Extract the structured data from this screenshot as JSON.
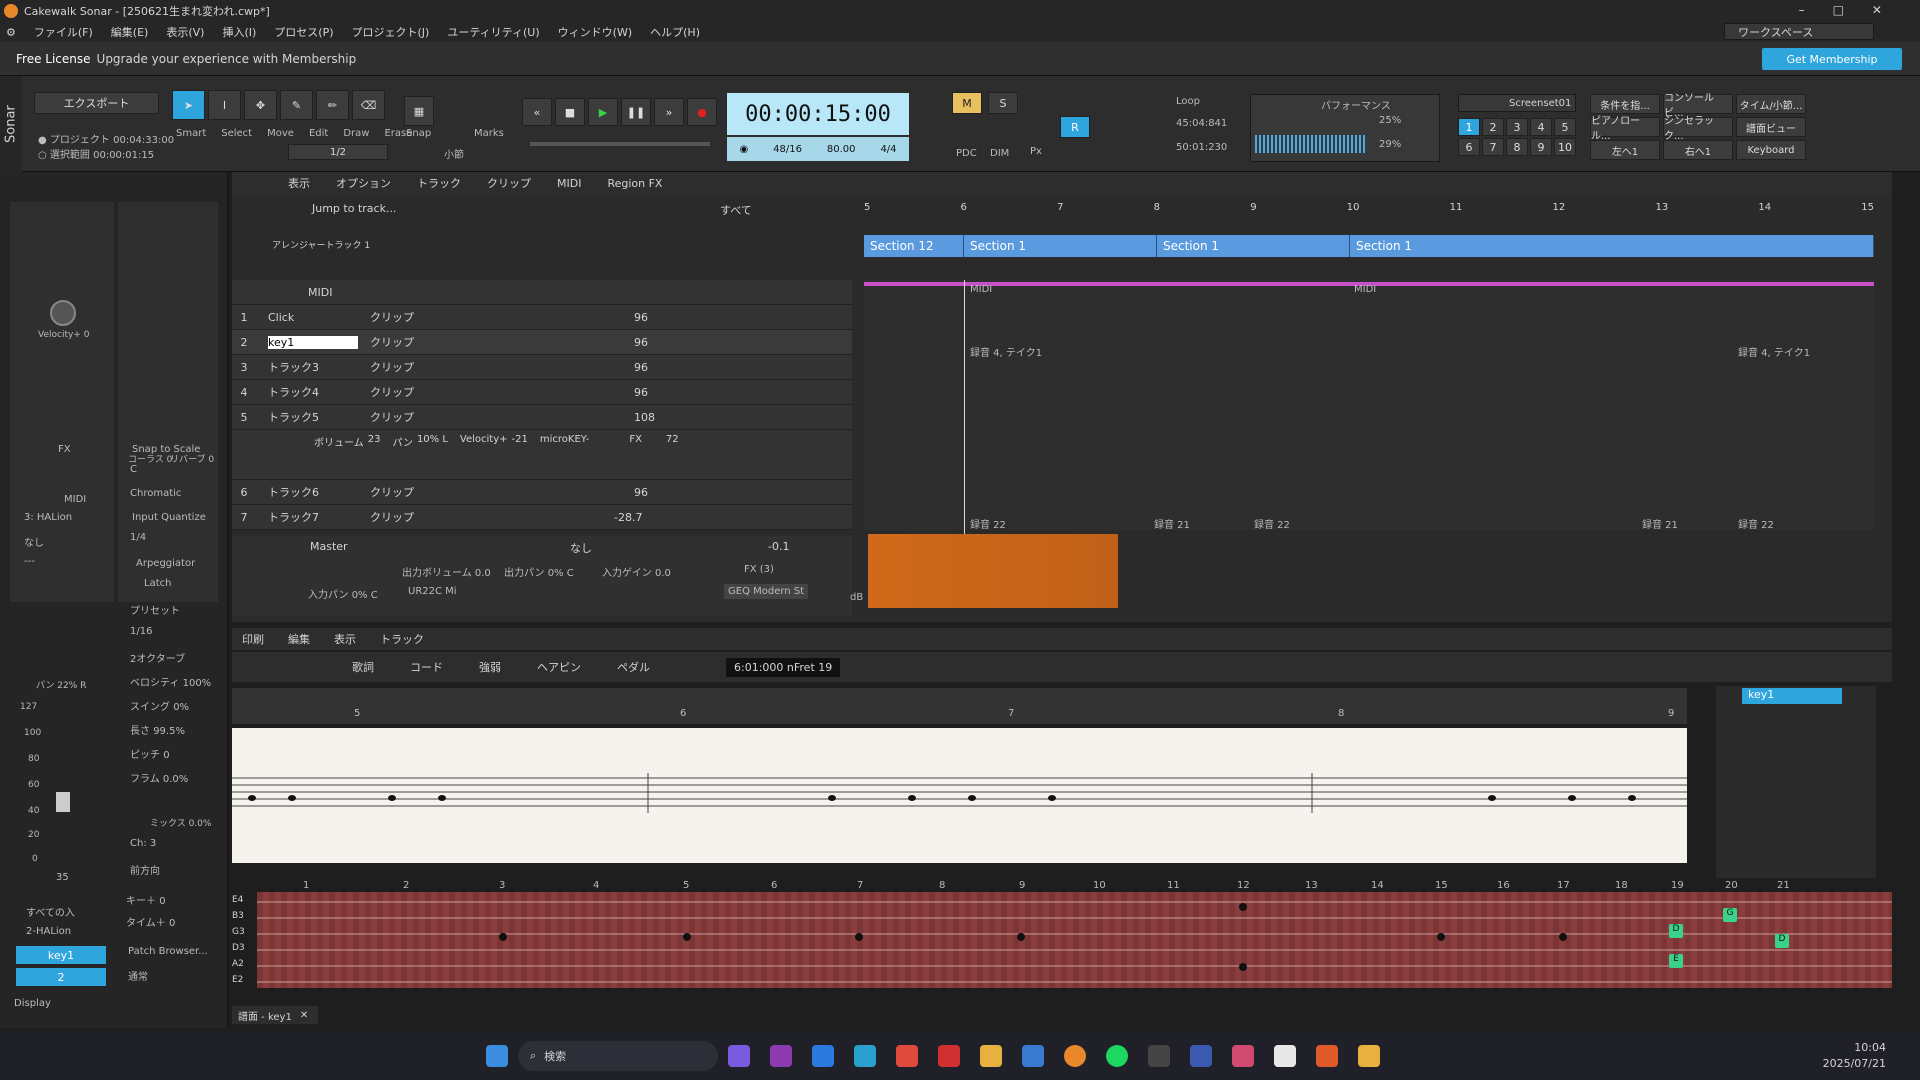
{
  "window": {
    "title": "Cakewalk Sonar - [250621生まれ変われ.cwp*]"
  },
  "menu": [
    "ファイル(F)",
    "編集(E)",
    "表示(V)",
    "挿入(I)",
    "プロセス(P)",
    "プロジェクト(J)",
    "ユーティリティ(U)",
    "ウィンドウ(W)",
    "ヘルプ(H)"
  ],
  "workspace": "ワークスペース",
  "license": {
    "label": "Free License",
    "upgrade": "Upgrade your experience with Membership",
    "button": "Get Membership"
  },
  "export": {
    "label": "エクスポート",
    "project": "● プロジェクト",
    "project_time": "00:04:33:00",
    "sel": "○ 選択範囲",
    "sel_time": "00:00:01:15"
  },
  "tools": [
    "Smart",
    "Select",
    "Move",
    "Edit",
    "Draw",
    "Erase"
  ],
  "snap": {
    "label": "Snap",
    "value": "1/2",
    "unit": "小節",
    "marks": "Marks"
  },
  "clock": {
    "time": "00:00:15:00",
    "meas": "48",
    "beat": "16",
    "tempo": "80.00",
    "sig": "4/4"
  },
  "mix": {
    "m": "M",
    "s": "S",
    "pdc": "PDC",
    "dim": "DIM",
    "px": "Px"
  },
  "loop": {
    "label": "Loop",
    "start": "45:04:841",
    "end": "50:01:230"
  },
  "perf": {
    "label": "パフォーマンス",
    "cpu": "25%",
    "disk": "29%"
  },
  "screenset": {
    "label": "Screenset01",
    "nums": [
      "1",
      "2",
      "3",
      "4",
      "5",
      "6",
      "7",
      "8",
      "9",
      "10"
    ]
  },
  "views": [
    "条件を指...",
    "コンソールビ...",
    "タイム/小節...",
    "ピアノロール...",
    "シンセラック...",
    "譜面ビュー",
    "左へ1",
    "右へ1",
    "Keyboard"
  ],
  "trackmenu": [
    "表示",
    "オプション",
    "トラック",
    "クリップ",
    "MIDI",
    "Region FX"
  ],
  "jump": "Jump to track...",
  "filter": "すべて",
  "arranger": "アレンジャートラック 1",
  "sections": [
    "Section 12",
    "Section 1",
    "Section 1",
    "Section 1"
  ],
  "ruler": [
    "5",
    "6",
    "7",
    "8",
    "9",
    "10",
    "11",
    "12",
    "13",
    "14",
    "15"
  ],
  "folder": "MIDI",
  "tracks": [
    {
      "n": "1",
      "name": "Click",
      "clip": "クリップ",
      "lvl": "96"
    },
    {
      "n": "2",
      "name": "key1",
      "clip": "クリップ",
      "lvl": "96"
    },
    {
      "n": "3",
      "name": "トラック3",
      "clip": "クリップ",
      "lvl": "96"
    },
    {
      "n": "4",
      "name": "トラック4",
      "clip": "クリップ",
      "lvl": "96"
    },
    {
      "n": "5",
      "name": "トラック5",
      "clip": "クリップ",
      "lvl": "108"
    },
    {
      "n": "6",
      "name": "トラック6",
      "clip": "クリップ",
      "lvl": "96"
    },
    {
      "n": "7",
      "name": "トラック7",
      "clip": "クリップ",
      "lvl": "-28.7"
    }
  ],
  "t5": {
    "vol": "ボリューム",
    "vol_v": "23",
    "pan": "パン",
    "pan_v": "10% L",
    "vel": "Velocity+",
    "vel_v": "-21",
    "inst": "microKEY-",
    "fx": "FX",
    "lvl2": "72"
  },
  "master": {
    "name": "Master",
    "out": "なし",
    "val": "-0.1",
    "outvol": "出力ボリューム",
    "outvol_v": "0.0",
    "outpan": "出力パン",
    "outpan_v": "0% C",
    "ingain": "入力ゲイン",
    "ingain_v": "0.0",
    "inpan": "入力パン",
    "inpan_v": "0% C",
    "iface": "UR22C Mi",
    "fx": "FX (3)",
    "plugin": "GEQ Modern St",
    "db": "dB"
  },
  "cliplabels": [
    "MIDI",
    "MIDI",
    "録音 4, テイク1",
    "録音 4, テイク1",
    "録音 22",
    "録音 21",
    "録音 22",
    "録音 21",
    "録音 22"
  ],
  "inspector": {
    "vel": "Velocity+ 0",
    "fx": "FX",
    "chorus": "コーラス 0",
    "reverb": "リバーブ 0",
    "snapscale": "Snap to Scale",
    "key": "C",
    "scale": "Chromatic",
    "iq": "Input Quantize",
    "iqv": "1/4",
    "arp": "Arpeggiator",
    "latch": "Latch",
    "preset": "プリセット",
    "rate": "1/16",
    "oct": "2オクターブ",
    "velo": "ベロシティ",
    "velo_v": "100%",
    "swing": "スイング",
    "swing_v": "0%",
    "len": "長さ",
    "len_v": "99.5%",
    "pitch": "ピッチ",
    "pitch_v": "0",
    "flam": "フラム",
    "flam_v": "0.0%",
    "mix": "ミックス 0.0%",
    "ch": "Ch: 3",
    "dir": "前方向",
    "keyplus": "キー＋",
    "keyplus_v": "0",
    "timeplus": "タイム＋ 0",
    "patch": "Patch Browser...",
    "normal": "通常",
    "midi": "MIDI",
    "in": "3: HALion",
    "bank": "なし",
    "prog": "---",
    "pan": "パン 22% R",
    "vol": "35",
    "allin": "すべての入",
    "out2": "2-HALion",
    "track": "key1",
    "tnum": "2",
    "display": "Display",
    "scale_marks": [
      "127",
      "100",
      "80",
      "60",
      "40",
      "20",
      "0"
    ]
  },
  "staffmenu": [
    "印刷",
    "編集",
    "表示",
    "トラック"
  ],
  "staffbar": [
    "歌詞",
    "コード",
    "強弱",
    "ヘアピン",
    "ペダル"
  ],
  "staffpos": "6:01:000  nFret 19",
  "staffruler": [
    "5",
    "6",
    "7",
    "8",
    "9"
  ],
  "staffkey": "key1",
  "fretnums": [
    "1",
    "2",
    "3",
    "4",
    "5",
    "6",
    "7",
    "8",
    "9",
    "10",
    "11",
    "12",
    "13",
    "14",
    "15",
    "16",
    "17",
    "18",
    "19",
    "20",
    "21"
  ],
  "strings": [
    "E4",
    "B3",
    "G3",
    "D3",
    "A2",
    "E2"
  ],
  "fretnotes": [
    "G",
    "D",
    "D",
    "E"
  ],
  "tab": "譜面 - key1",
  "taskbar": {
    "search": "検索",
    "time": "10:04",
    "date": "2025/07/21"
  },
  "colors": {
    "accent": "#2ea5dc",
    "clip": "#d06a1a",
    "section": "#5a9be0",
    "midi": "#c850c8"
  }
}
